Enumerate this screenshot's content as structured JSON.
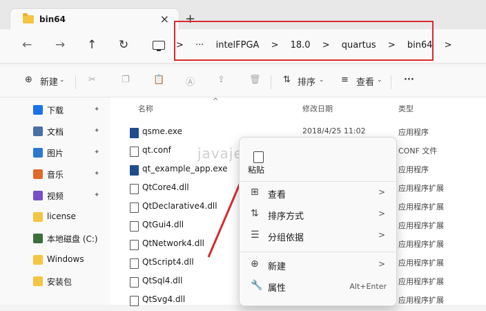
{
  "tab": {
    "title": "bin64",
    "close": "×",
    "new": "+"
  },
  "nav": {
    "back": "←",
    "forward": "→",
    "up": "↑",
    "refresh": "↻",
    "crumb_more": "···",
    "sep": ">"
  },
  "breadcrumb": [
    "intelFPGA",
    "18.0",
    "quartus",
    "bin64"
  ],
  "toolbar": {
    "new": "新建",
    "sort": "排序",
    "view": "查看",
    "more": "···"
  },
  "sidebar": [
    {
      "label": "下载",
      "icon": "download-icon",
      "color": "#1a73e8",
      "pinned": true
    },
    {
      "label": "文档",
      "icon": "document-icon",
      "color": "#4a6fa5",
      "pinned": true
    },
    {
      "label": "图片",
      "icon": "picture-icon",
      "color": "#2b78d2",
      "pinned": true
    },
    {
      "label": "音乐",
      "icon": "music-icon",
      "color": "#e06a2c",
      "pinned": true
    },
    {
      "label": "视频",
      "icon": "video-icon",
      "color": "#7a4ec9",
      "pinned": true
    },
    {
      "label": "license",
      "icon": "folder-icon",
      "color": "#f4c542",
      "pinned": false
    },
    {
      "label": "本地磁盘 (C:)",
      "icon": "drive-icon",
      "color": "#3c6e3c",
      "pinned": false
    },
    {
      "label": "Windows",
      "icon": "folder-icon",
      "color": "#f4c542",
      "pinned": false
    },
    {
      "label": "安装包",
      "icon": "folder-icon",
      "color": "#f4c542",
      "pinned": false
    }
  ],
  "columns": {
    "name": "名称",
    "date": "修改日期",
    "type": "类型"
  },
  "files": [
    {
      "name": "qsme.exe",
      "date": "2018/4/25 11:02",
      "type": "应用程序",
      "kind": "exe"
    },
    {
      "name": "qt.conf",
      "date": "",
      "type": "CONF 文件",
      "kind": "file"
    },
    {
      "name": "qt_example_app.exe",
      "date": "",
      "type": "应用程序",
      "kind": "exe"
    },
    {
      "name": "QtCore4.dll",
      "date": "",
      "type": "应用程序扩展",
      "kind": "dll"
    },
    {
      "name": "QtDeclarative4.dll",
      "date": "",
      "type": "应用程序扩展",
      "kind": "dll"
    },
    {
      "name": "QtGui4.dll",
      "date": "",
      "type": "应用程序扩展",
      "kind": "dll"
    },
    {
      "name": "QtNetwork4.dll",
      "date": "",
      "type": "应用程序扩展",
      "kind": "dll"
    },
    {
      "name": "QtScript4.dll",
      "date": "",
      "type": "应用程序扩展",
      "kind": "dll"
    },
    {
      "name": "QtSql4.dll",
      "date": "",
      "type": "应用程序扩展",
      "kind": "dll"
    },
    {
      "name": "QtSvg4.dll",
      "date": "",
      "type": "应用程序扩展",
      "kind": "dll"
    }
  ],
  "context_menu": {
    "paste": "粘贴",
    "items": [
      {
        "label": "查看",
        "icon": "grid-icon",
        "glyph": "⊞",
        "chevron": ">"
      },
      {
        "label": "排序方式",
        "icon": "sort-icon",
        "glyph": "⇅",
        "chevron": ">"
      },
      {
        "label": "分组依据",
        "icon": "group-icon",
        "glyph": "☰",
        "chevron": ">"
      },
      {
        "label": "新建",
        "icon": "add-circle-icon",
        "glyph": "⊕",
        "chevron": ">"
      },
      {
        "label": "属性",
        "icon": "wrench-icon",
        "glyph": "🔧",
        "shortcut": "Alt+Enter"
      }
    ]
  },
  "watermark": "javajenius",
  "colors": {
    "highlight": "#d9292e",
    "arrow": "#d9292e"
  }
}
